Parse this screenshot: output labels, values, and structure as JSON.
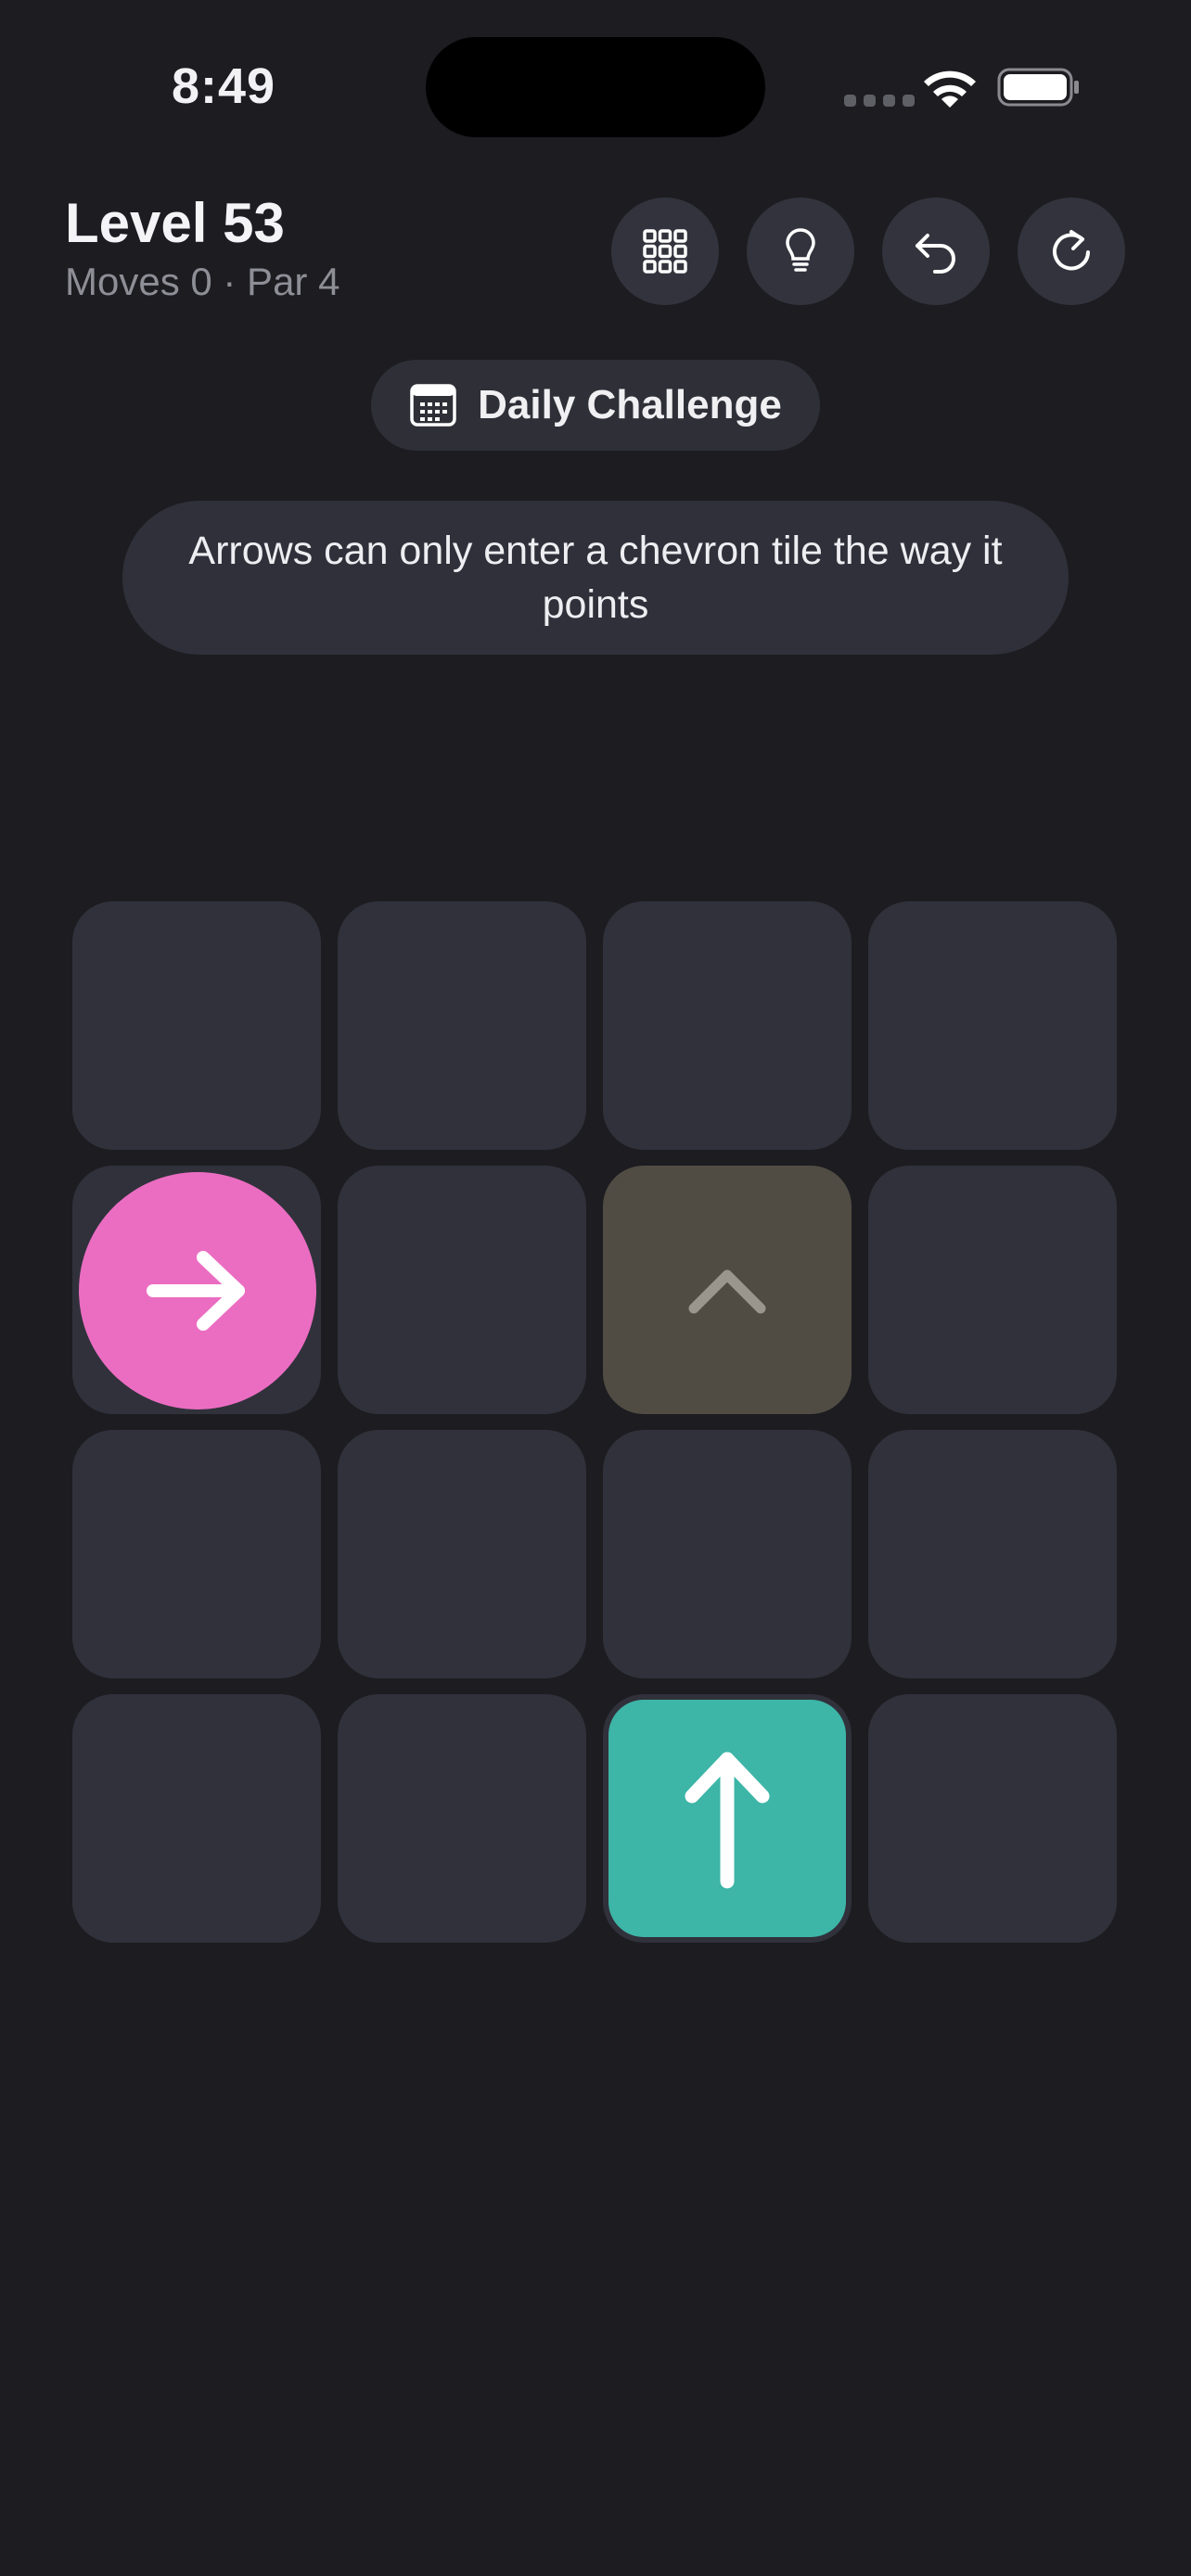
{
  "status_bar": {
    "time": "8:49"
  },
  "header": {
    "title": "Level 53",
    "subtitle": "Moves 0 · Par 4"
  },
  "toolbar": {
    "buttons": [
      {
        "name": "level-select",
        "icon": "grid-icon"
      },
      {
        "name": "hint",
        "icon": "lightbulb-icon"
      },
      {
        "name": "undo",
        "icon": "undo-icon"
      },
      {
        "name": "restart",
        "icon": "restart-icon"
      }
    ]
  },
  "chip": {
    "label": "Daily Challenge",
    "icon": "calendar-icon"
  },
  "hint_text": "Arrows can only enter a chevron tile the way it points",
  "board": {
    "rows": 4,
    "cols": 4,
    "pieces": [
      {
        "type": "arrow-circle",
        "direction": "right",
        "row": 2,
        "col": 1,
        "color": "#eb6dc2"
      },
      {
        "type": "chevron-tile",
        "direction": "up",
        "row": 2,
        "col": 3,
        "color": "#514c43"
      },
      {
        "type": "arrow-square",
        "direction": "up",
        "row": 4,
        "col": 3,
        "color": "#3db5a7"
      }
    ]
  },
  "colors": {
    "background": "#1c1c21",
    "cell": "#31313b",
    "button": "#33333d"
  }
}
